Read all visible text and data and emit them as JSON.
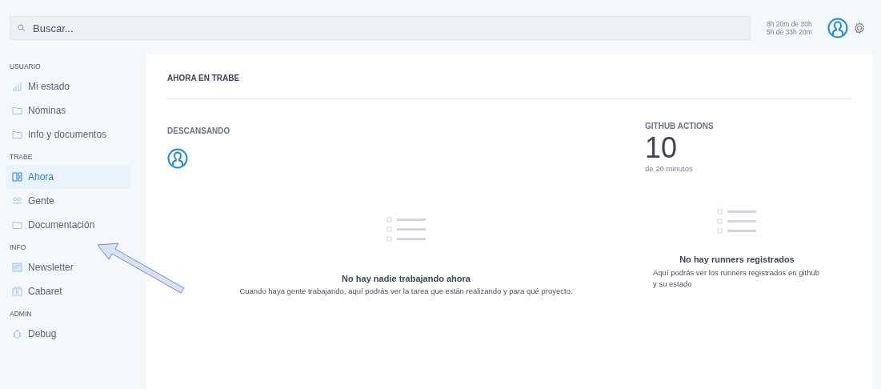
{
  "search": {
    "placeholder": "Buscar..."
  },
  "time_summary": [
    "8h 20m de 30h",
    "5h de 33h 20m"
  ],
  "sidebar": {
    "sections": [
      {
        "title": "USUARIO",
        "items": [
          {
            "label": "Mi estado",
            "selected": false
          },
          {
            "label": "Nóminas",
            "selected": false
          },
          {
            "label": "Info y documentos",
            "selected": false
          }
        ]
      },
      {
        "title": "TRABE",
        "items": [
          {
            "label": "Ahora",
            "selected": true
          },
          {
            "label": "Gente",
            "selected": false
          },
          {
            "label": "Documentación",
            "selected": false
          }
        ]
      },
      {
        "title": "INFO",
        "items": [
          {
            "label": "Newsletter",
            "selected": false
          },
          {
            "label": "Cabaret",
            "selected": false
          }
        ]
      },
      {
        "title": "ADMIN",
        "items": [
          {
            "label": "Debug",
            "selected": false
          }
        ]
      }
    ]
  },
  "main": {
    "title": "AHORA EN TRABE",
    "resting": {
      "title": "DESCANSANDO"
    },
    "github": {
      "title": "GITHUB ACTIONS",
      "value": "10",
      "caption": "de 20 minutos"
    },
    "empty_work": {
      "title": "No hay nadie trabajando ahora",
      "text": "Cuando haya gente trabajando, aquí podrás ver la tarea que están realizando y para qué proyecto."
    },
    "empty_runners": {
      "title": "No hay runners registrados",
      "text": "Aquí podrás ver los runners registrados en github y su estado"
    }
  }
}
